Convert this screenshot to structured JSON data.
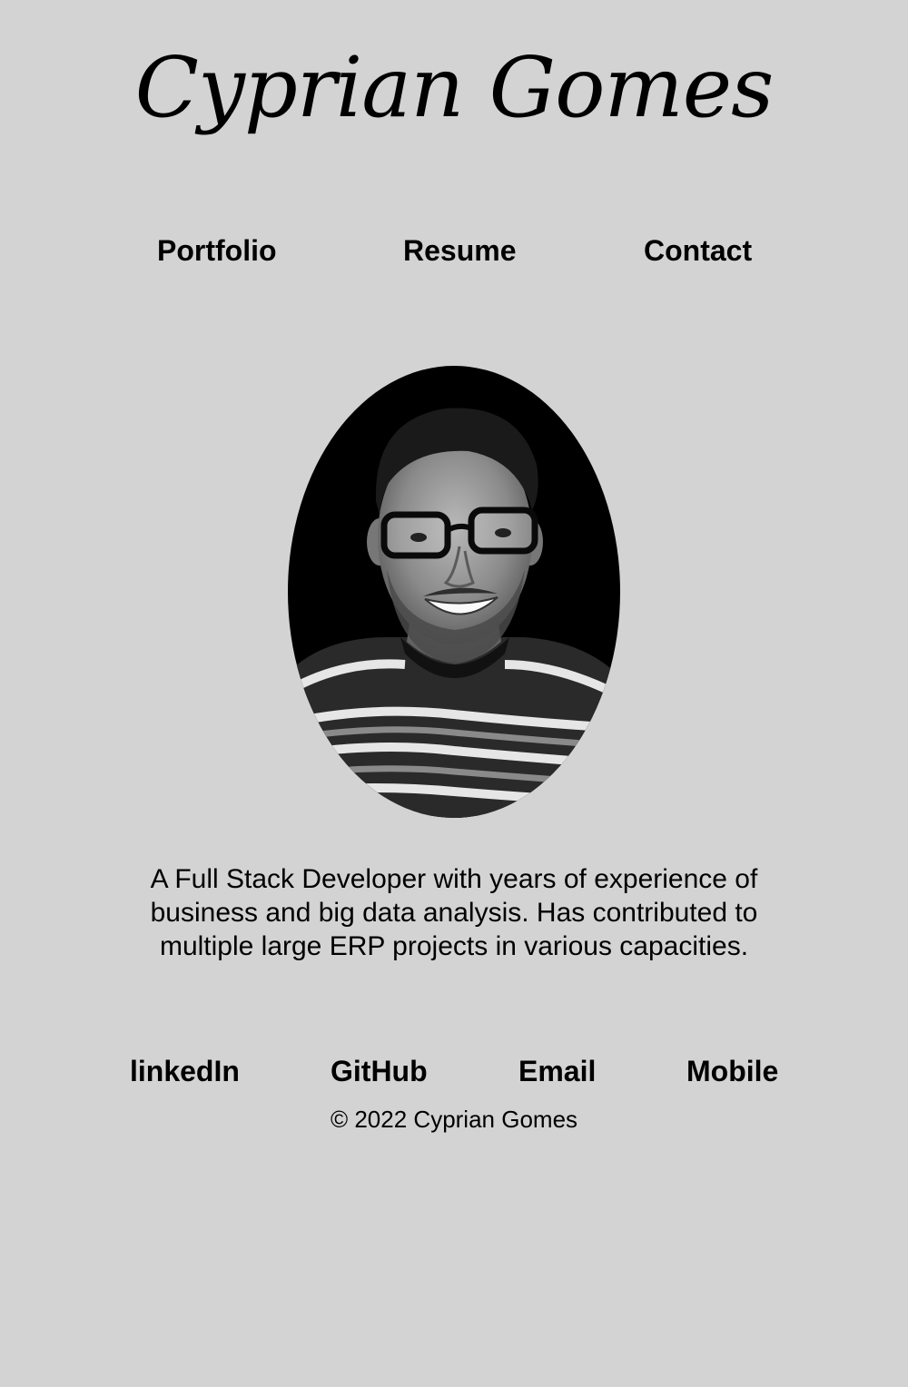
{
  "header": {
    "title": "Cyprian Gomes"
  },
  "nav": {
    "items": [
      {
        "label": "Portfolio"
      },
      {
        "label": "Resume"
      },
      {
        "label": "Contact"
      }
    ]
  },
  "profile": {
    "photo_icon": "portrait-photo",
    "bio": "A Full Stack Developer with years of experience of business and big data analysis. Has contributed to multiple large ERP projects in various capacities."
  },
  "footer": {
    "links": [
      {
        "label": "linkedIn"
      },
      {
        "label": "GitHub"
      },
      {
        "label": "Email"
      },
      {
        "label": "Mobile"
      }
    ],
    "copyright": "© 2022 Cyprian Gomes"
  },
  "colors": {
    "background": "#d3d3d3",
    "text": "#000000"
  }
}
